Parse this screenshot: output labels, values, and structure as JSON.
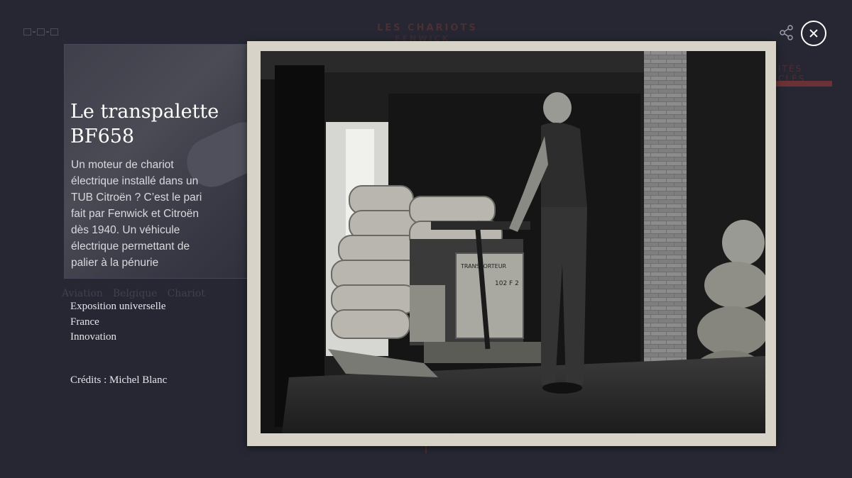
{
  "background": {
    "brand_line1": "LES CHARIOTS",
    "brand_line2": "FENWICK",
    "right_tab_label": "ITÉS CLÉS",
    "tags": [
      "Aviation",
      "Belgique",
      "Chariot"
    ]
  },
  "modal": {
    "title": "Le transpalette BF658",
    "description": "Un moteur de chariot électrique installé dans un TUB Citroën ? C’est le pari fait par Fenwick et Citroën dès 1940. Un véhicule électrique permettant de palier à la pénurie",
    "tags": [
      "Exposition universelle",
      "France",
      "Innovation"
    ],
    "credits": "Crédits : Michel Blanc",
    "photo_plate_text": "TRANSPORTEUR",
    "photo_id_text": "102 F 2"
  },
  "controls": {
    "share_icon": "share-icon",
    "close_icon": "close-icon"
  }
}
